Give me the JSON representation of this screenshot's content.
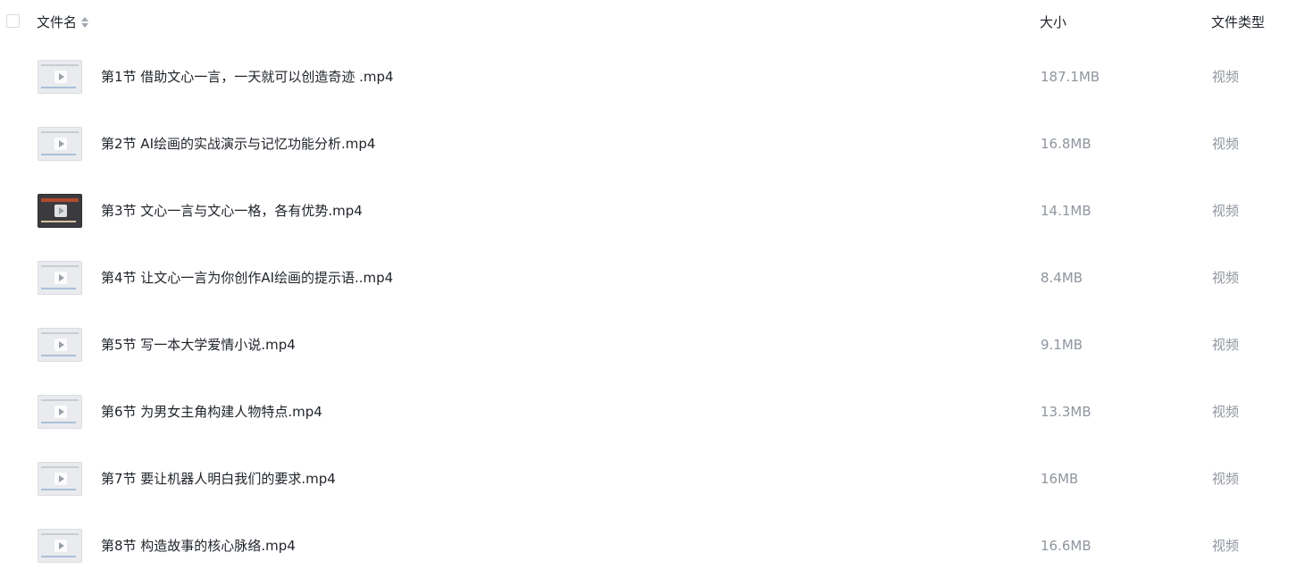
{
  "header": {
    "name_label": "文件名",
    "size_label": "大小",
    "type_label": "文件类型"
  },
  "files": [
    {
      "name": "第1节 借助文心一言，一天就可以创造奇迹 .mp4",
      "size": "187.1MB",
      "type": "视频"
    },
    {
      "name": "第2节 AI绘画的实战演示与记忆功能分析.mp4",
      "size": "16.8MB",
      "type": "视频"
    },
    {
      "name": "第3节 文心一言与文心一格，各有优势.mp4",
      "size": "14.1MB",
      "type": "视频"
    },
    {
      "name": "第4节 让文心一言为你创作AI绘画的提示语..mp4",
      "size": "8.4MB",
      "type": "视频"
    },
    {
      "name": "第5节 写一本大学爱情小说.mp4",
      "size": "9.1MB",
      "type": "视频"
    },
    {
      "name": "第6节 为男女主角构建人物特点.mp4",
      "size": "13.3MB",
      "type": "视频"
    },
    {
      "name": "第7节 要让机器人明白我们的要求.mp4",
      "size": "16MB",
      "type": "视频"
    },
    {
      "name": "第8节 构造故事的核心脉络.mp4",
      "size": "16.6MB",
      "type": "视频"
    }
  ]
}
